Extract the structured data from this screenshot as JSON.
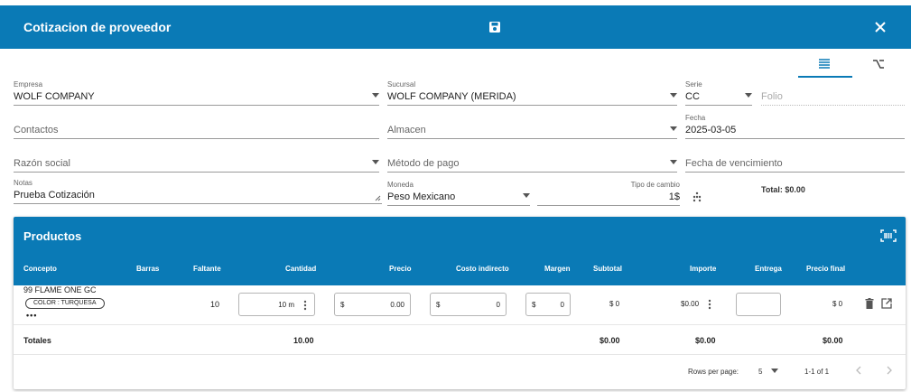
{
  "header": {
    "title": "Cotizacion de proveedor",
    "save_icon": "save-icon",
    "close_icon": "close-icon",
    "color": "#0a7ab6"
  },
  "view_tabs": [
    {
      "icon": "list-icon",
      "active": true
    },
    {
      "icon": "tree-icon",
      "active": false
    }
  ],
  "form": {
    "empresa": {
      "label": "Empresa",
      "value": "WOLF COMPANY"
    },
    "sucursal": {
      "label": "Sucursal",
      "value": "WOLF COMPANY (MERIDA)"
    },
    "serie": {
      "label": "Serie",
      "value": "CC"
    },
    "folio": {
      "placeholder": "Folio"
    },
    "contactos": {
      "placeholder": "Contactos"
    },
    "almacen": {
      "placeholder": "Almacen"
    },
    "fecha": {
      "label": "Fecha",
      "value": "2025-03-05"
    },
    "razon_social": {
      "placeholder": "Razón social"
    },
    "metodo_pago": {
      "placeholder": "Método de pago"
    },
    "fecha_vencimiento": {
      "placeholder": "Fecha de vencimiento"
    },
    "notas": {
      "label": "Notas",
      "value": "Prueba Cotización"
    },
    "moneda": {
      "label": "Moneda",
      "value": "Peso Mexicano"
    },
    "tipo_cambio": {
      "label": "Tipo de cambio",
      "value": "1$"
    },
    "total": "Total: $0.00"
  },
  "productos": {
    "title": "Productos",
    "columns": {
      "concepto": "Concepto",
      "barras": "Barras",
      "faltante": "Faltante",
      "cantidad": "Cantidad",
      "precio": "Precio",
      "costo_indirecto": "Costo indirecto",
      "margen": "Margen",
      "subtotal": "Subtotal",
      "importe": "Importe",
      "entrega": "Entrega",
      "precio_final": "Precio final"
    },
    "rows": [
      {
        "concepto": "99 FLAME ONE GC",
        "chip": "COLOR : TURQUESA",
        "more": "•••",
        "faltante": "10",
        "cantidad": "10 m",
        "precio_prefix": "$",
        "precio": "0.00",
        "costo_prefix": "$",
        "costo": "0",
        "margen_prefix": "$",
        "margen": "0",
        "subtotal": "$ 0",
        "importe": "$0.00",
        "precio_final": "$ 0"
      }
    ],
    "totals": {
      "label": "Totales",
      "cantidad": "10.00",
      "subtotal": "$0.00",
      "importe": "$0.00",
      "precio_final": "$0.00"
    },
    "pagination": {
      "rows_per_page_label": "Rows per page:",
      "rows_per_page": "5",
      "range": "1-1 of 1"
    }
  }
}
